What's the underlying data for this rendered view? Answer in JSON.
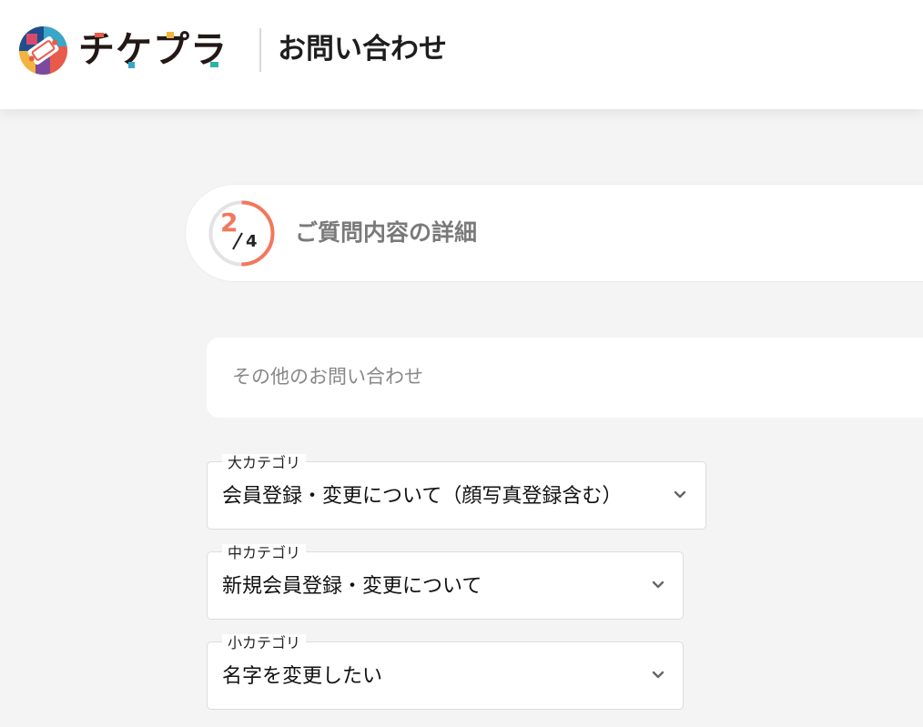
{
  "header": {
    "brand": "チケプラ",
    "title": "お問い合わせ"
  },
  "step": {
    "current": "2",
    "total": "4",
    "progress": 0.5,
    "title": "ご質問内容の詳細"
  },
  "inquiry_type": {
    "label": "その他のお問い合わせ"
  },
  "categories": {
    "large": {
      "legend": "大カテゴリ",
      "value": "会員登録・変更について（顔写真登録含む）"
    },
    "medium": {
      "legend": "中カテゴリ",
      "value": "新規会員登録・変更について"
    },
    "small": {
      "legend": "小カテゴリ",
      "value": "名字を変更したい"
    }
  },
  "colors": {
    "accent": "#f2785c",
    "background": "#f4f4f4",
    "muted_text": "#7a7a7a"
  },
  "icons": {
    "logo": "ticket-logo-icon",
    "chevron": "chevron-down-icon"
  }
}
